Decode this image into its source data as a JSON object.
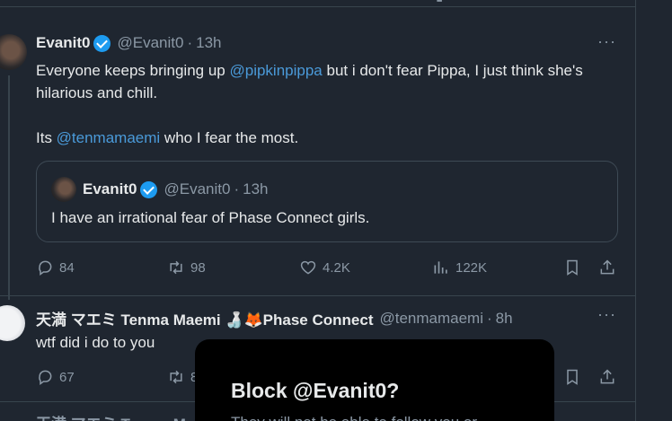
{
  "tweets": [
    {
      "name": "Evanit0",
      "handle": "@Evanit0",
      "dot": "·",
      "time": "13h",
      "more": "···",
      "text_line1_prefix": "Everyone keeps bringing up ",
      "text_line1_mention": "@pipkinpippa",
      "text_line1_suffix": " but i don't fear Pippa, I just think she's hilarious and chill.",
      "text_line2_prefix": "Its ",
      "text_line2_mention": "@tenmamaemi",
      "text_line2_suffix": " who I fear the most.",
      "quote": {
        "name": "Evanit0",
        "handle": "@Evanit0",
        "dot": "·",
        "time": "13h",
        "text": "I have an irrational fear of Phase Connect girls."
      },
      "stats": {
        "replies": "84",
        "retweets": "98",
        "likes": "4.2K",
        "views": "122K"
      }
    },
    {
      "name": "天満 マエミ Tenma Maemi 🍶🦊Phase Connect",
      "handle": "@tenmamaemi",
      "dot": "·",
      "time": "8h",
      "more": "···",
      "text": "wtf did i do to you",
      "stats": {
        "replies": "67",
        "retweets": "8"
      }
    }
  ],
  "next_tweet_partial": "天満 マエミ Tenma Mae",
  "modal": {
    "title": "Block @Evanit0?",
    "description": "They will not be able to follow you or"
  },
  "colors": {
    "background": "#1f2630",
    "accent": "#1d9bf0",
    "mention": "#4a9ad9",
    "muted": "#8b98a5"
  }
}
